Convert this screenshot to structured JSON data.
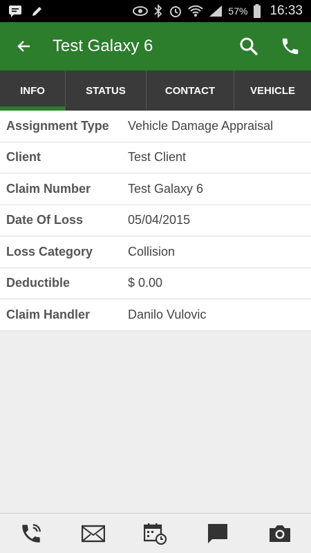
{
  "status": {
    "battery": "57%",
    "time": "16:33"
  },
  "appbar": {
    "title": "Test Galaxy 6"
  },
  "tabs": [
    {
      "label": "INFO",
      "active": true
    },
    {
      "label": "STATUS",
      "active": false
    },
    {
      "label": "CONTACT",
      "active": false
    },
    {
      "label": "VEHICLE",
      "active": false
    }
  ],
  "info": [
    {
      "label": "Assignment Type",
      "value": "Vehicle Damage Appraisal"
    },
    {
      "label": "Client",
      "value": "Test Client"
    },
    {
      "label": "Claim Number",
      "value": "Test Galaxy 6"
    },
    {
      "label": "Date Of Loss",
      "value": "05/04/2015"
    },
    {
      "label": "Loss Category",
      "value": "Collision"
    },
    {
      "label": "Deductible",
      "value": "$ 0.00"
    },
    {
      "label": "Claim Handler",
      "value": "Danilo Vulovic"
    }
  ],
  "colors": {
    "primary": "#2c7d2c",
    "tabbar": "#3a3a3a"
  },
  "icons": [
    "phone-icon",
    "email-icon",
    "calendar-icon",
    "chat-icon",
    "camera-icon"
  ]
}
